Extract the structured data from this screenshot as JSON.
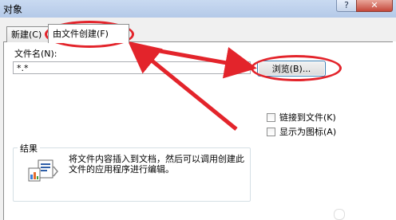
{
  "window": {
    "title": "对象",
    "help_glyph": "?",
    "close_glyph": "✕"
  },
  "tabs": [
    {
      "label": "新建(C)",
      "selected": false
    },
    {
      "label": "由文件创建(F)",
      "selected": true
    }
  ],
  "form": {
    "filename_label": "文件名(N):",
    "filename_value": "*.*",
    "browse_label": "浏览(B)...",
    "link_to_file_label": "链接到文件(K)",
    "link_to_file_checked": false,
    "display_as_icon_label": "显示为图标(A)",
    "display_as_icon_checked": false
  },
  "result": {
    "title": "结果",
    "description": "将文件内容插入到文档，然后可以调用创建此文件的应用程序进行编辑。"
  },
  "annotation": {
    "color": "#e3242b"
  }
}
